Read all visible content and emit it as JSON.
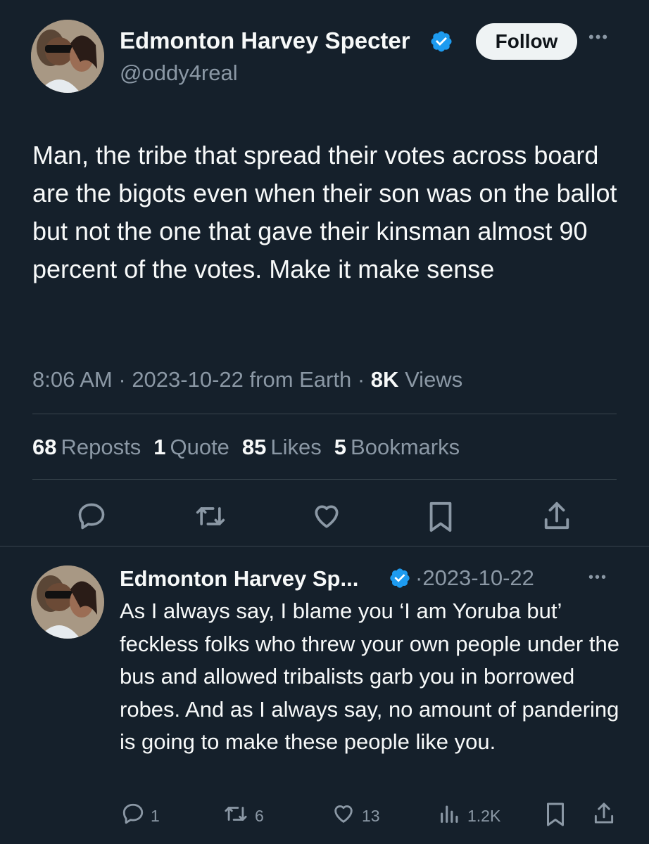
{
  "main_tweet": {
    "author_name": "Edmonton Harvey Specter",
    "handle": "@oddy4real",
    "follow_label": "Follow",
    "more_label": "•••",
    "text": "Man, the tribe that spread their votes across board are the bigots even when their son was on the ballot but not the one that gave their kinsman almost 90 percent of the votes. Make it make sense",
    "time": "8:06 AM",
    "date": "2023-10-22",
    "source": "from Earth",
    "views_count": "8K",
    "views_label": "Views",
    "stats": {
      "reposts_count": "68",
      "reposts_label": "Reposts",
      "quote_count": "1",
      "quote_label": "Quote",
      "likes_count": "85",
      "likes_label": "Likes",
      "bookmarks_count": "5",
      "bookmarks_label": "Bookmarks"
    }
  },
  "reply": {
    "author_name": "Edmonton Harvey Sp...",
    "date": "2023-10-22",
    "more_label": "•••",
    "text": "As I always say, I blame you ‘I am Yoruba but’ feckless folks who threw your own people under the bus and allowed tribalists garb you in borrowed robes. And as I always say, no amount of pandering is going to make these people like you.",
    "replies": "1",
    "reposts": "6",
    "likes": "13",
    "views": "1.2K"
  },
  "colors": {
    "background": "#15202b",
    "verified": "#1d9bf0",
    "muted": "#8b98a5",
    "divider": "#38444d"
  },
  "icons": [
    "verified-badge-icon",
    "reply-icon",
    "repost-icon",
    "like-icon",
    "bookmark-icon",
    "share-icon",
    "views-icon"
  ]
}
